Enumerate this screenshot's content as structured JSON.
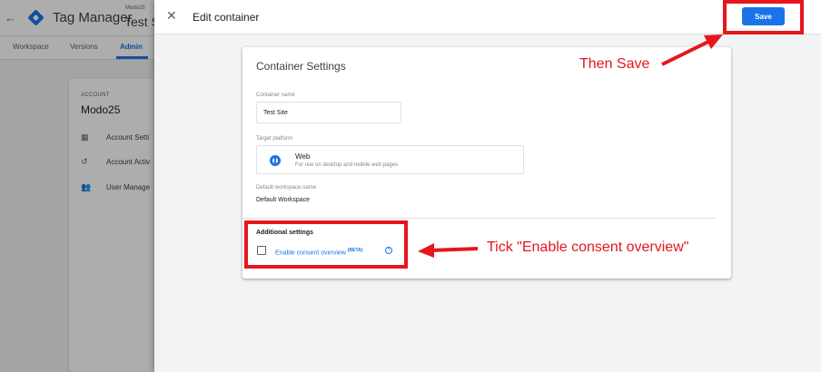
{
  "background": {
    "product_name": "Tag Manager",
    "account_small": "Modo25",
    "container_name": "Test S",
    "back_glyph": "←",
    "tabs": [
      {
        "label": "Workspace",
        "active": false
      },
      {
        "label": "Versions",
        "active": false
      },
      {
        "label": "Admin",
        "active": true
      }
    ],
    "account_label": "ACCOUNT",
    "account_name": "Modo25",
    "menu": [
      {
        "icon": "building-icon",
        "glyph": "▦",
        "label": "Account Setti"
      },
      {
        "icon": "history-icon",
        "glyph": "↺",
        "label": "Account Activ"
      },
      {
        "icon": "people-icon",
        "glyph": "👥",
        "label": "User Manage"
      }
    ]
  },
  "panel": {
    "close_glyph": "✕",
    "title": "Edit container",
    "save_label": "Save",
    "card_title": "Container Settings",
    "container_name_label": "Container name",
    "container_name_value": "Test Site",
    "target_platform_label": "Target platform",
    "platform_name": "Web",
    "platform_desc": "For use on desktop and mobile web pages",
    "workspace_label": "Default workspace name",
    "workspace_value": "Default Workspace",
    "additional_title": "Additional settings",
    "consent_label": "Enable consent overview",
    "beta_label": "(BETA)",
    "help_glyph": "?",
    "consent_checked": false
  },
  "annotations": {
    "save_note": "Then Save",
    "consent_note": "Tick \"Enable consent overview\"",
    "color": "#e6161c"
  },
  "colors": {
    "accent": "#1a73e8",
    "annotation": "#e6161c"
  }
}
